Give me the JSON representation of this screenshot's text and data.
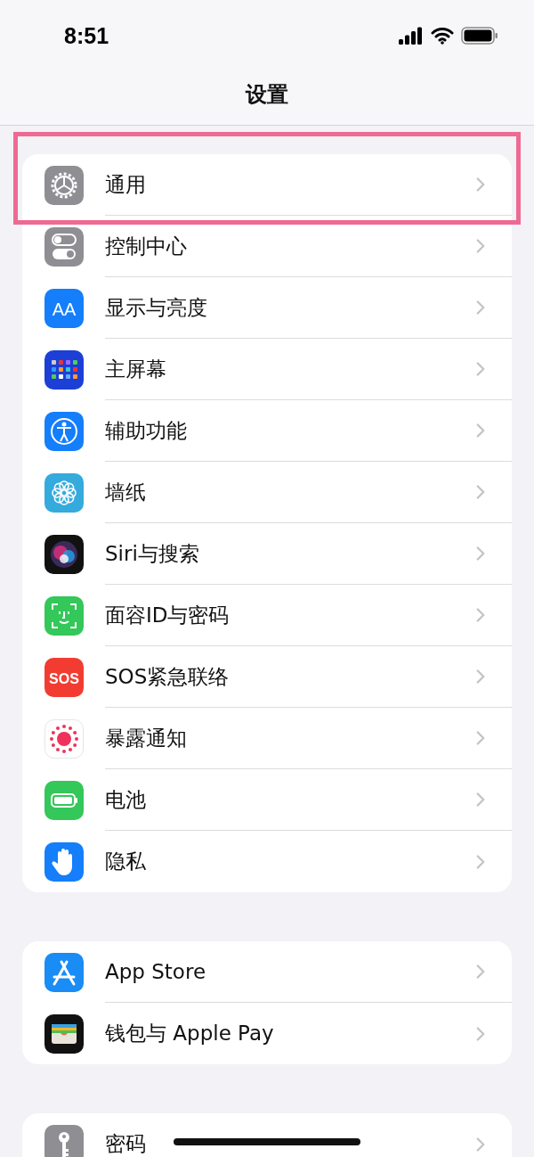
{
  "status_bar": {
    "time": "8:51"
  },
  "nav": {
    "title": "设置"
  },
  "groups": [
    {
      "items": [
        {
          "label": "通用",
          "kind": "gear",
          "highlighted": true
        },
        {
          "label": "控制中心",
          "kind": "toggles",
          "highlighted": false
        },
        {
          "label": "显示与亮度",
          "kind": "text-size",
          "icon_text": "AA",
          "highlighted": false
        },
        {
          "label": "主屏幕",
          "kind": "grid",
          "highlighted": false
        },
        {
          "label": "辅助功能",
          "kind": "accessibility",
          "highlighted": false
        },
        {
          "label": "墙纸",
          "kind": "flower",
          "highlighted": false
        },
        {
          "label": "Siri与搜索",
          "kind": "siri",
          "highlighted": false
        },
        {
          "label": "面容ID与密码",
          "kind": "face",
          "highlighted": false
        },
        {
          "label": "SOS紧急联络",
          "kind": "sos",
          "icon_text": "SOS",
          "highlighted": false
        },
        {
          "label": "暴露通知",
          "kind": "exposure",
          "highlighted": false
        },
        {
          "label": "电池",
          "kind": "battery",
          "highlighted": false
        },
        {
          "label": "隐私",
          "kind": "hand",
          "highlighted": false
        }
      ]
    },
    {
      "items": [
        {
          "label": "App Store",
          "kind": "appstore",
          "highlighted": false
        },
        {
          "label": "钱包与 Apple Pay",
          "kind": "wallet",
          "highlighted": false
        }
      ]
    },
    {
      "items": [
        {
          "label": "密码",
          "kind": "key",
          "highlighted": false
        }
      ]
    }
  ]
}
